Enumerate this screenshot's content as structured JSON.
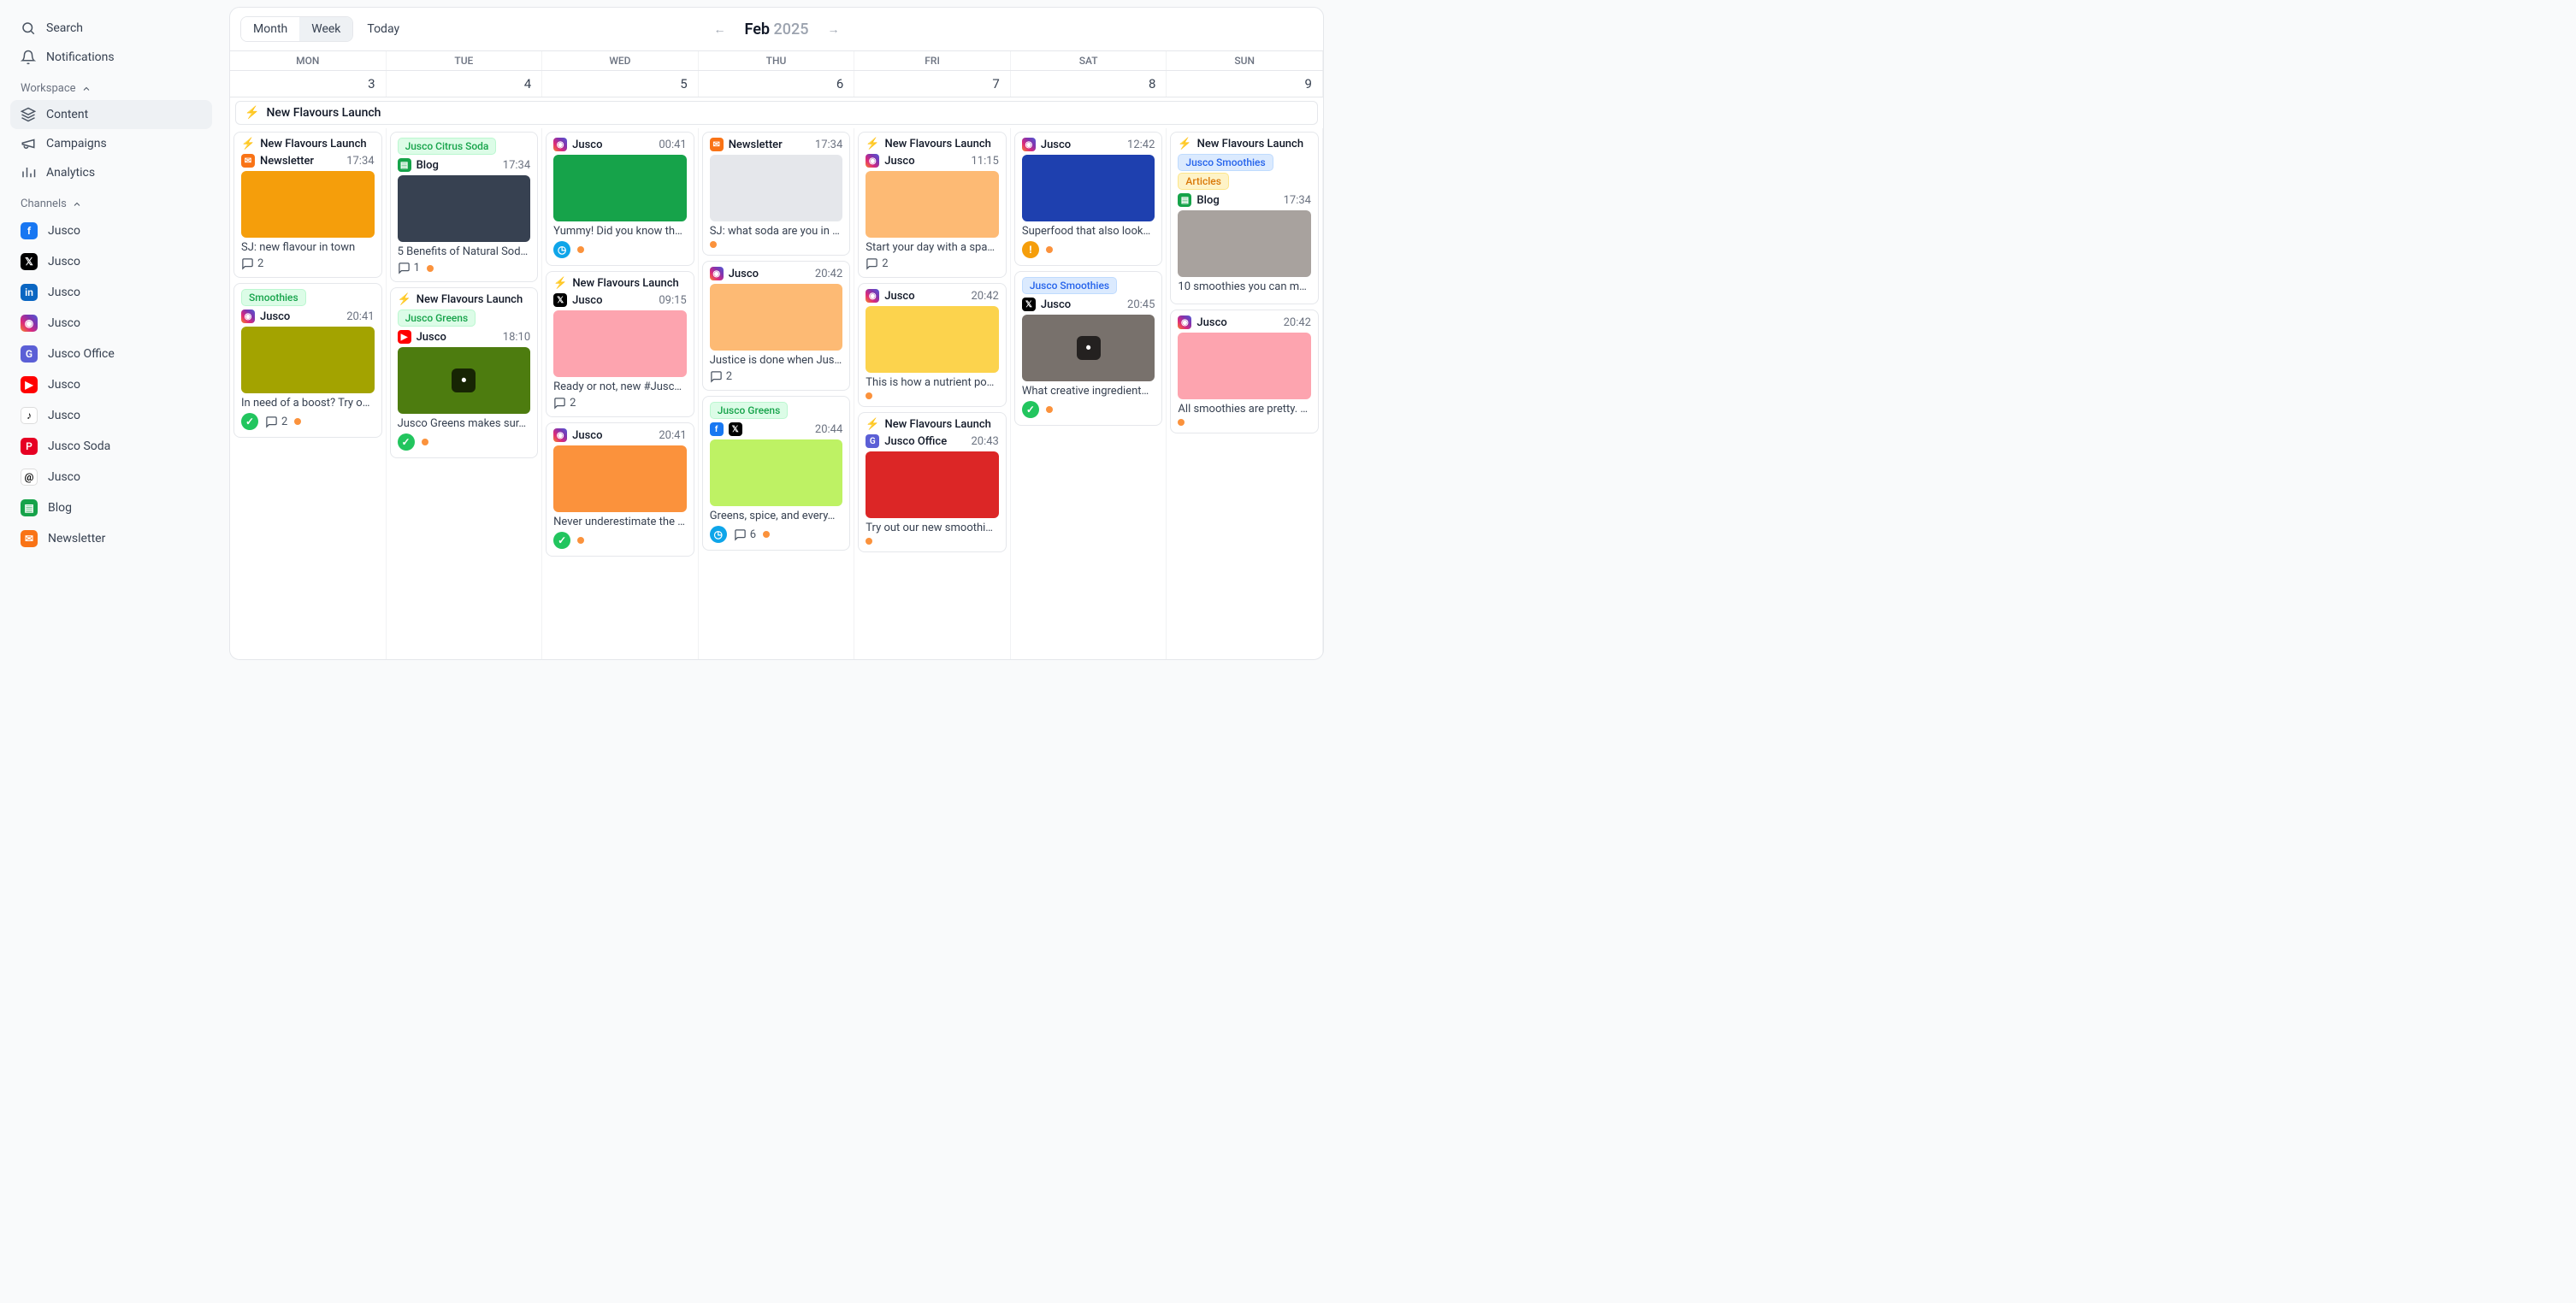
{
  "sidebar": {
    "search": "Search",
    "notifications": "Notifications",
    "workspace_label": "Workspace",
    "workspace": [
      {
        "label": "Content",
        "icon": "layers",
        "active": true
      },
      {
        "label": "Campaigns",
        "icon": "megaphone"
      },
      {
        "label": "Analytics",
        "icon": "chart"
      }
    ],
    "channels_label": "Channels",
    "channels": [
      {
        "label": "Jusco",
        "brand": "fb"
      },
      {
        "label": "Jusco",
        "brand": "x"
      },
      {
        "label": "Jusco",
        "brand": "li"
      },
      {
        "label": "Jusco",
        "brand": "ig"
      },
      {
        "label": "Jusco Office",
        "brand": "g"
      },
      {
        "label": "Jusco",
        "brand": "yt"
      },
      {
        "label": "Jusco",
        "brand": "tt"
      },
      {
        "label": "Jusco Soda",
        "brand": "pn"
      },
      {
        "label": "Jusco",
        "brand": "th"
      },
      {
        "label": "Blog",
        "brand": "bl"
      },
      {
        "label": "Newsletter",
        "brand": "nl"
      }
    ]
  },
  "calendar": {
    "views": {
      "month": "Month",
      "week": "Week",
      "today": "Today"
    },
    "active_view": "week",
    "month": "Feb",
    "year": "2025",
    "days": [
      "MON",
      "TUE",
      "WED",
      "THU",
      "FRI",
      "SAT",
      "SUN"
    ],
    "dates": [
      "3",
      "4",
      "5",
      "6",
      "7",
      "8",
      "9"
    ],
    "spanning": [
      {
        "label": "New Flavours Launch"
      }
    ]
  },
  "brand_glyphs": {
    "fb": "f",
    "x": "𝕏",
    "li": "in",
    "ig": "◉",
    "g": "G",
    "yt": "▶",
    "tt": "♪",
    "pn": "P",
    "th": "@",
    "bl": "▤",
    "nl": "✉"
  },
  "icons": {
    "comment": "💬"
  },
  "columns": [
    [
      {
        "header": {
          "icon": "bolt",
          "label": "New Flavours Launch"
        },
        "channel": {
          "brand": "nl",
          "label": "Newsletter",
          "time": "17:34"
        },
        "thumb": "#f59e0b",
        "caption": "SJ: new flavour in town",
        "meta": {
          "comments": "2"
        }
      },
      {
        "tags": [
          {
            "text": "Smoothies",
            "style": "green"
          }
        ],
        "channel": {
          "brand": "ig",
          "label": "Jusco",
          "time": "20:41"
        },
        "thumb": "#a3a300",
        "caption": "In need of a boost? Try o…",
        "meta": {
          "badge": "check",
          "comments": "2",
          "dot": true
        }
      }
    ],
    [
      {
        "tags": [
          {
            "text": "Jusco Citrus Soda",
            "style": "green"
          }
        ],
        "channel": {
          "brand": "bl",
          "label": "Blog",
          "time": "17:34"
        },
        "thumb": "#374151",
        "caption": "5 Benefits of Natural Sod…",
        "meta": {
          "comments": "1",
          "dot": true
        }
      },
      {
        "header": {
          "icon": "bolt",
          "label": "New Flavours Launch"
        },
        "tags": [
          {
            "text": "Jusco Greens",
            "style": "green"
          }
        ],
        "channel": {
          "brand": "yt",
          "label": "Jusco",
          "time": "18:10"
        },
        "thumb": "#4d7c0f",
        "video": true,
        "caption": "Jusco Greens makes sur…",
        "meta": {
          "badge": "check",
          "dot": true
        }
      }
    ],
    [
      {
        "channel": {
          "brand": "ig",
          "label": "Jusco",
          "time": "00:41"
        },
        "thumb": "#16a34a",
        "caption": "Yummy! Did you know th…",
        "meta": {
          "badge": "clock",
          "dot": true
        }
      },
      {
        "header": {
          "icon": "bolt",
          "label": "New Flavours Launch"
        },
        "channel": {
          "brand": "x",
          "label": "Jusco",
          "time": "09:15"
        },
        "thumb": "#fda4af",
        "caption": "Ready or not, new #Jusc…",
        "meta": {
          "comments": "2"
        }
      },
      {
        "channel": {
          "brand": "ig",
          "label": "Jusco",
          "time": "20:41"
        },
        "thumb": "#fb923c",
        "caption": "Never underestimate the …",
        "meta": {
          "badge": "check",
          "dot": true
        }
      }
    ],
    [
      {
        "channel": {
          "brand": "nl",
          "label": "Newsletter",
          "time": "17:34"
        },
        "thumb": "#e5e7eb",
        "caption": "SJ: what soda are you in …",
        "meta": {
          "dot": true
        }
      },
      {
        "channel": {
          "brand": "ig",
          "label": "Jusco",
          "time": "20:42"
        },
        "thumb": "#fdba74",
        "caption": "Justice is done when Jus…",
        "meta": {
          "comments": "2"
        }
      },
      {
        "tags": [
          {
            "text": "Jusco Greens",
            "style": "green"
          }
        ],
        "channel": {
          "brands": [
            "fb",
            "x"
          ],
          "time": "20:44"
        },
        "thumb": "#bef264",
        "caption": "Greens, spice, and every…",
        "meta": {
          "badge": "clock",
          "comments": "6",
          "dot": true
        }
      }
    ],
    [
      {
        "header": {
          "icon": "bolt",
          "label": "New Flavours Launch"
        },
        "channel": {
          "brand": "ig",
          "label": "Jusco",
          "time": "11:15"
        },
        "thumb": "#fdba74",
        "caption": "Start your day with a spa…",
        "meta": {
          "comments": "2"
        }
      },
      {
        "channel": {
          "brand": "ig",
          "label": "Jusco",
          "time": "20:42"
        },
        "thumb": "#fcd34d",
        "caption": "This is how a nutrient po…",
        "meta": {
          "dot": true
        }
      },
      {
        "header": {
          "icon": "bolt",
          "label": "New Flavours Launch"
        },
        "channel": {
          "brand": "g",
          "label": "Jusco Office",
          "time": "20:43"
        },
        "thumb": "#dc2626",
        "caption": "Try out our new smoothi…",
        "meta": {
          "dot": true
        }
      }
    ],
    [
      {
        "channel": {
          "brand": "ig",
          "label": "Jusco",
          "time": "12:42"
        },
        "thumb": "#1e40af",
        "caption": "Superfood that also look…",
        "meta": {
          "badge": "warn",
          "dot": true
        }
      },
      {
        "tags": [
          {
            "text": "Jusco Smoothies",
            "style": "blue"
          }
        ],
        "channel": {
          "brand": "x",
          "label": "Jusco",
          "time": "20:45"
        },
        "thumb": "#78716c",
        "video": true,
        "caption": "What creative ingredient…",
        "meta": {
          "badge": "check",
          "dot": true
        }
      }
    ],
    [
      {
        "header": {
          "icon": "bolt",
          "label": "New Flavours Launch"
        },
        "tags": [
          {
            "text": "Jusco Smoothies",
            "style": "blue"
          },
          {
            "text": "Articles",
            "style": "amber"
          }
        ],
        "channel": {
          "brand": "bl",
          "label": "Blog",
          "time": "17:34"
        },
        "thumb": "#a8a29e",
        "caption": "10 smoothies you can ma…"
      },
      {
        "channel": {
          "brand": "ig",
          "label": "Jusco",
          "time": "20:42"
        },
        "thumb": "#fda4af",
        "caption": "All smoothies are pretty. …",
        "meta": {
          "dot": true
        }
      }
    ]
  ]
}
